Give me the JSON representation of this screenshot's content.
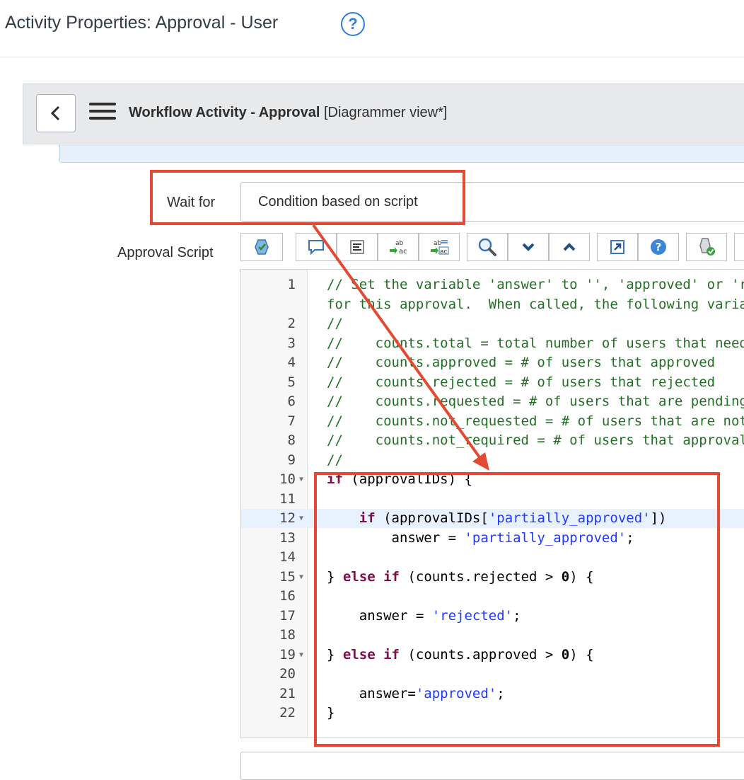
{
  "page_title": "Activity Properties: Approval - User",
  "help_symbol": "?",
  "header": {
    "record_title": "Workflow Activity - Approval",
    "view_label": "[Diagrammer view*]"
  },
  "form": {
    "wait_for": {
      "label": "Wait for",
      "value": "Condition based on script"
    },
    "approval_script": {
      "label": "Approval Script"
    }
  },
  "toolbar": [
    {
      "icon": "syntax-check-icon"
    },
    {
      "icon": "comment-icon"
    },
    {
      "icon": "format-code-icon"
    },
    {
      "icon": "replace-icon"
    },
    {
      "icon": "replace-all-icon"
    },
    {
      "icon": "search-icon"
    },
    {
      "icon": "chevron-down-icon"
    },
    {
      "icon": "chevron-up-icon"
    },
    {
      "icon": "fullscreen-icon"
    },
    {
      "icon": "help-icon"
    },
    {
      "icon": "script-debugger-icon"
    }
  ],
  "code": [
    {
      "n": "1",
      "text": "// Set the variable 'answer' to '', 'approved' or 'rejected' to indicate the approval"
    },
    {
      "n": "",
      "text": "for this approval.  When called, the following variables are available:"
    },
    {
      "n": "2",
      "text": "//"
    },
    {
      "n": "3",
      "text": "//    counts.total = total number of users that need to approve"
    },
    {
      "n": "4",
      "text": "//    counts.approved = # of users that approved"
    },
    {
      "n": "5",
      "text": "//    counts.rejected = # of users that rejected"
    },
    {
      "n": "6",
      "text": "//    counts.requested = # of users that are pending"
    },
    {
      "n": "7",
      "text": "//    counts.not_requested = # of users that are not yet requested"
    },
    {
      "n": "8",
      "text": "//    counts.not_required = # of users that approval is not required"
    },
    {
      "n": "9",
      "text": "//"
    },
    {
      "n": "10",
      "fold": true,
      "text": "if (approvalIDs) {"
    },
    {
      "n": "11",
      "text": ""
    },
    {
      "n": "12",
      "fold": true,
      "active": true,
      "text": "    if (approvalIDs['partially_approved'])"
    },
    {
      "n": "13",
      "text": "        answer = 'partially_approved';"
    },
    {
      "n": "14",
      "text": ""
    },
    {
      "n": "15",
      "fold": true,
      "text": "} else if (counts.rejected > 0) {"
    },
    {
      "n": "16",
      "text": ""
    },
    {
      "n": "17",
      "text": "    answer = 'rejected';"
    },
    {
      "n": "18",
      "text": ""
    },
    {
      "n": "19",
      "fold": true,
      "text": "} else if (counts.approved > 0) {"
    },
    {
      "n": "20",
      "text": ""
    },
    {
      "n": "21",
      "text": "    answer='approved';"
    },
    {
      "n": "22",
      "text": "}"
    }
  ],
  "colors": {
    "highlight": "#e24a33",
    "accent": "#2b7de1",
    "keyword": "#7a0f4b",
    "string": "#1f3aff",
    "comment": "#236e25"
  }
}
